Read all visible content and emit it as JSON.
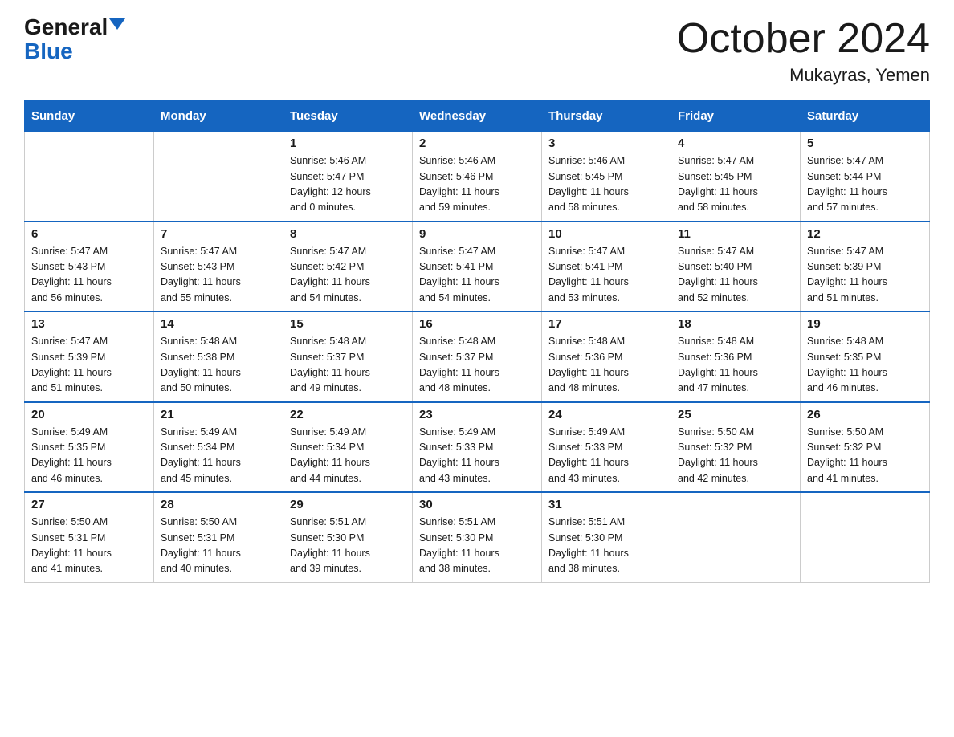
{
  "logo": {
    "general": "General",
    "blue": "Blue"
  },
  "title": {
    "month": "October 2024",
    "location": "Mukayras, Yemen"
  },
  "days_of_week": [
    "Sunday",
    "Monday",
    "Tuesday",
    "Wednesday",
    "Thursday",
    "Friday",
    "Saturday"
  ],
  "weeks": [
    [
      {
        "day": "",
        "info": ""
      },
      {
        "day": "",
        "info": ""
      },
      {
        "day": "1",
        "info": "Sunrise: 5:46 AM\nSunset: 5:47 PM\nDaylight: 12 hours\nand 0 minutes."
      },
      {
        "day": "2",
        "info": "Sunrise: 5:46 AM\nSunset: 5:46 PM\nDaylight: 11 hours\nand 59 minutes."
      },
      {
        "day": "3",
        "info": "Sunrise: 5:46 AM\nSunset: 5:45 PM\nDaylight: 11 hours\nand 58 minutes."
      },
      {
        "day": "4",
        "info": "Sunrise: 5:47 AM\nSunset: 5:45 PM\nDaylight: 11 hours\nand 58 minutes."
      },
      {
        "day": "5",
        "info": "Sunrise: 5:47 AM\nSunset: 5:44 PM\nDaylight: 11 hours\nand 57 minutes."
      }
    ],
    [
      {
        "day": "6",
        "info": "Sunrise: 5:47 AM\nSunset: 5:43 PM\nDaylight: 11 hours\nand 56 minutes."
      },
      {
        "day": "7",
        "info": "Sunrise: 5:47 AM\nSunset: 5:43 PM\nDaylight: 11 hours\nand 55 minutes."
      },
      {
        "day": "8",
        "info": "Sunrise: 5:47 AM\nSunset: 5:42 PM\nDaylight: 11 hours\nand 54 minutes."
      },
      {
        "day": "9",
        "info": "Sunrise: 5:47 AM\nSunset: 5:41 PM\nDaylight: 11 hours\nand 54 minutes."
      },
      {
        "day": "10",
        "info": "Sunrise: 5:47 AM\nSunset: 5:41 PM\nDaylight: 11 hours\nand 53 minutes."
      },
      {
        "day": "11",
        "info": "Sunrise: 5:47 AM\nSunset: 5:40 PM\nDaylight: 11 hours\nand 52 minutes."
      },
      {
        "day": "12",
        "info": "Sunrise: 5:47 AM\nSunset: 5:39 PM\nDaylight: 11 hours\nand 51 minutes."
      }
    ],
    [
      {
        "day": "13",
        "info": "Sunrise: 5:47 AM\nSunset: 5:39 PM\nDaylight: 11 hours\nand 51 minutes."
      },
      {
        "day": "14",
        "info": "Sunrise: 5:48 AM\nSunset: 5:38 PM\nDaylight: 11 hours\nand 50 minutes."
      },
      {
        "day": "15",
        "info": "Sunrise: 5:48 AM\nSunset: 5:37 PM\nDaylight: 11 hours\nand 49 minutes."
      },
      {
        "day": "16",
        "info": "Sunrise: 5:48 AM\nSunset: 5:37 PM\nDaylight: 11 hours\nand 48 minutes."
      },
      {
        "day": "17",
        "info": "Sunrise: 5:48 AM\nSunset: 5:36 PM\nDaylight: 11 hours\nand 48 minutes."
      },
      {
        "day": "18",
        "info": "Sunrise: 5:48 AM\nSunset: 5:36 PM\nDaylight: 11 hours\nand 47 minutes."
      },
      {
        "day": "19",
        "info": "Sunrise: 5:48 AM\nSunset: 5:35 PM\nDaylight: 11 hours\nand 46 minutes."
      }
    ],
    [
      {
        "day": "20",
        "info": "Sunrise: 5:49 AM\nSunset: 5:35 PM\nDaylight: 11 hours\nand 46 minutes."
      },
      {
        "day": "21",
        "info": "Sunrise: 5:49 AM\nSunset: 5:34 PM\nDaylight: 11 hours\nand 45 minutes."
      },
      {
        "day": "22",
        "info": "Sunrise: 5:49 AM\nSunset: 5:34 PM\nDaylight: 11 hours\nand 44 minutes."
      },
      {
        "day": "23",
        "info": "Sunrise: 5:49 AM\nSunset: 5:33 PM\nDaylight: 11 hours\nand 43 minutes."
      },
      {
        "day": "24",
        "info": "Sunrise: 5:49 AM\nSunset: 5:33 PM\nDaylight: 11 hours\nand 43 minutes."
      },
      {
        "day": "25",
        "info": "Sunrise: 5:50 AM\nSunset: 5:32 PM\nDaylight: 11 hours\nand 42 minutes."
      },
      {
        "day": "26",
        "info": "Sunrise: 5:50 AM\nSunset: 5:32 PM\nDaylight: 11 hours\nand 41 minutes."
      }
    ],
    [
      {
        "day": "27",
        "info": "Sunrise: 5:50 AM\nSunset: 5:31 PM\nDaylight: 11 hours\nand 41 minutes."
      },
      {
        "day": "28",
        "info": "Sunrise: 5:50 AM\nSunset: 5:31 PM\nDaylight: 11 hours\nand 40 minutes."
      },
      {
        "day": "29",
        "info": "Sunrise: 5:51 AM\nSunset: 5:30 PM\nDaylight: 11 hours\nand 39 minutes."
      },
      {
        "day": "30",
        "info": "Sunrise: 5:51 AM\nSunset: 5:30 PM\nDaylight: 11 hours\nand 38 minutes."
      },
      {
        "day": "31",
        "info": "Sunrise: 5:51 AM\nSunset: 5:30 PM\nDaylight: 11 hours\nand 38 minutes."
      },
      {
        "day": "",
        "info": ""
      },
      {
        "day": "",
        "info": ""
      }
    ]
  ]
}
